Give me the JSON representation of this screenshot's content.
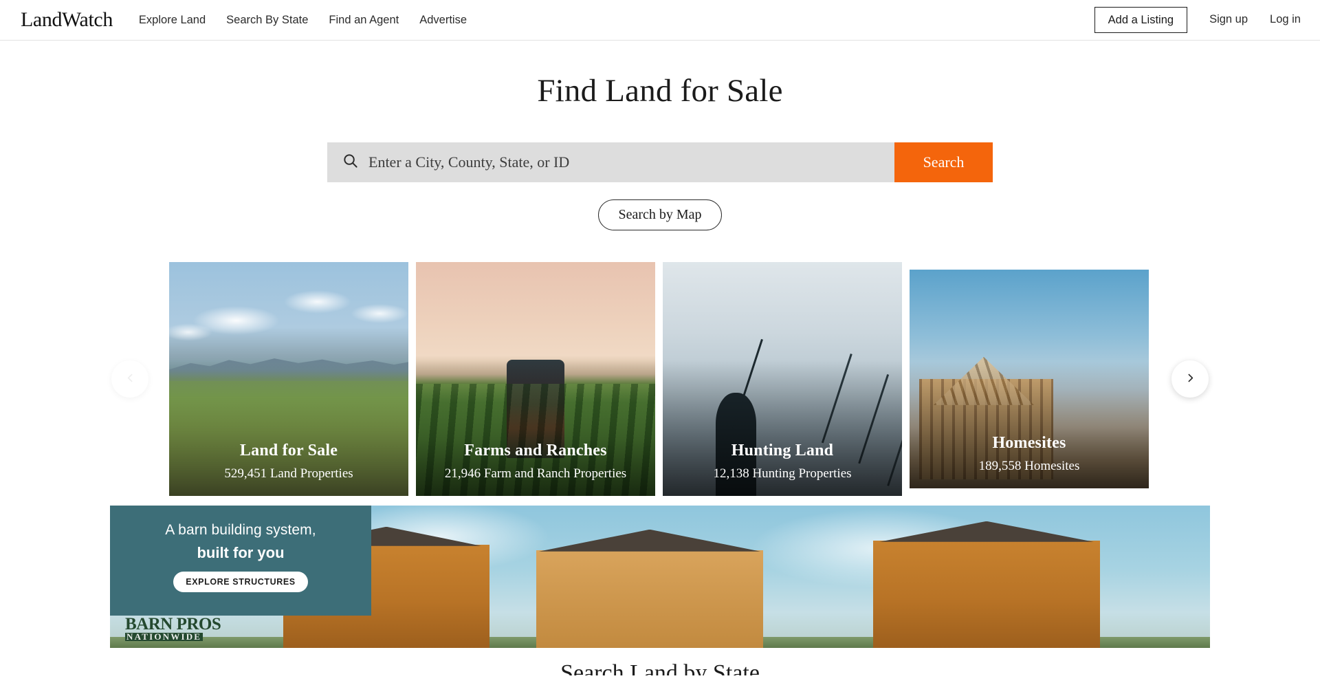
{
  "header": {
    "logo": "LandWatch",
    "nav": [
      {
        "label": "Explore Land"
      },
      {
        "label": "Search By State"
      },
      {
        "label": "Find an Agent"
      },
      {
        "label": "Advertise"
      }
    ],
    "add_listing_label": "Add a Listing",
    "sign_up_label": "Sign up",
    "log_in_label": "Log in"
  },
  "hero": {
    "title": "Find Land for Sale",
    "search_placeholder": "Enter a City, County, State, or ID",
    "search_value": "",
    "search_button_label": "Search",
    "map_button_label": "Search by Map",
    "search_icon": "search-icon",
    "accent_color": "#f4650c"
  },
  "carousel": {
    "prev_icon": "chevron-left-icon",
    "next_icon": "chevron-right-icon",
    "cards": [
      {
        "title": "Land for Sale",
        "subtitle": "529,451 Land Properties",
        "scene": "sc-land"
      },
      {
        "title": "Farms and Ranches",
        "subtitle": "21,946 Farm and Ranch Properties",
        "scene": "sc-farm"
      },
      {
        "title": "Hunting Land",
        "subtitle": "12,138 Hunting Properties",
        "scene": "sc-hunt"
      },
      {
        "title": "Homesites",
        "subtitle": "189,558 Homesites",
        "scene": "sc-home"
      }
    ]
  },
  "ad": {
    "line1": "A barn building system,",
    "line2": "built for you",
    "cta_label": "EXPLORE STRUCTURES",
    "brand_main": "BARN PROS",
    "brand_sub": "NATIONWIDE",
    "panel_color": "#3d6e78"
  },
  "bottom_section": {
    "heading": "Search Land by State"
  }
}
